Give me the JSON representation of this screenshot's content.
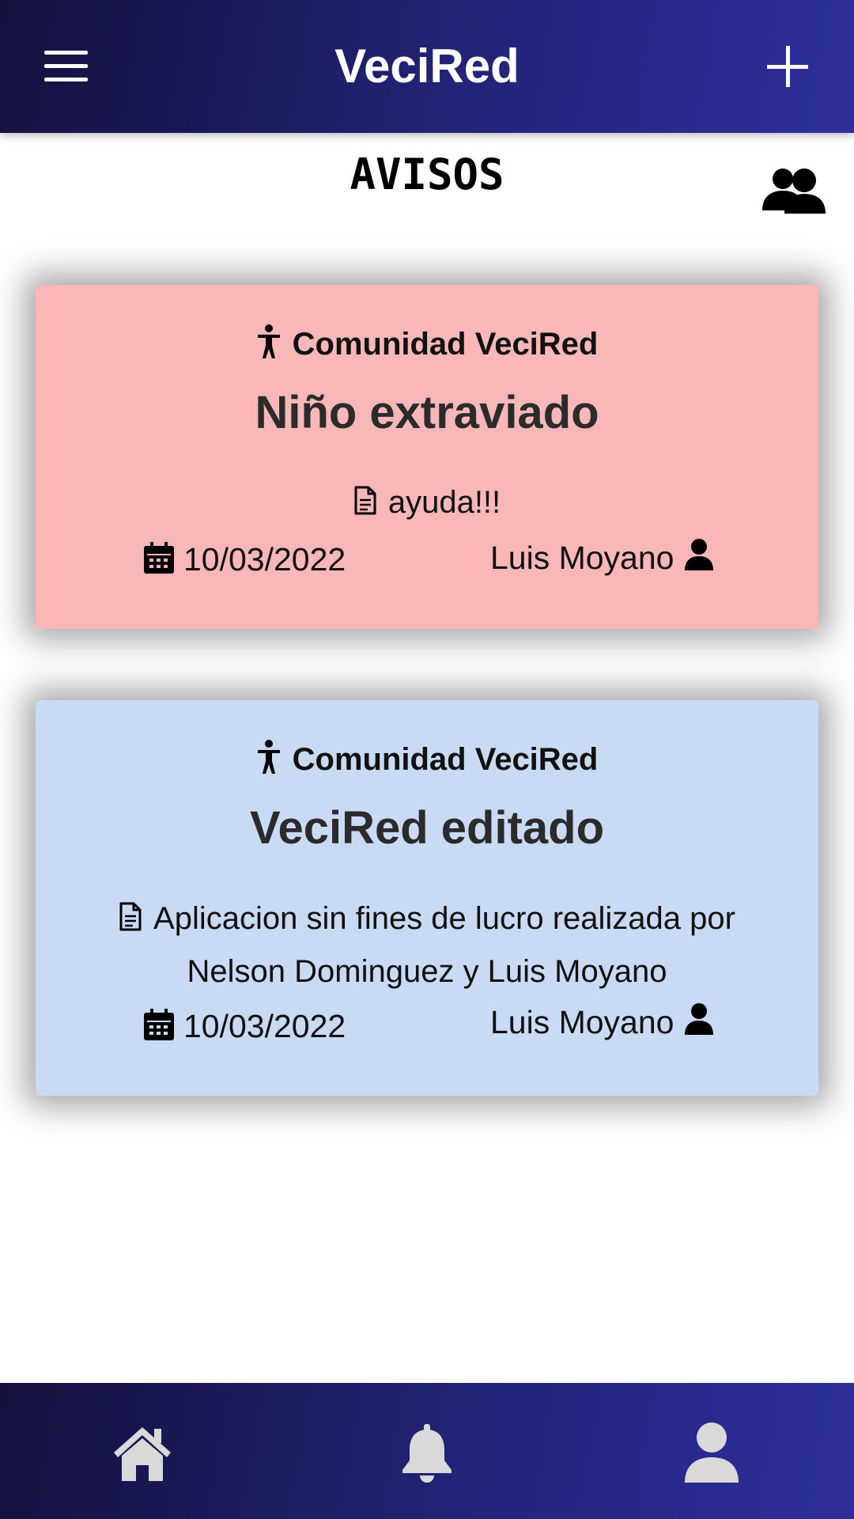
{
  "header": {
    "title": "VeciRed",
    "menu_icon": "hamburger-menu-icon",
    "add_icon": "plus-icon"
  },
  "page": {
    "title": "AVISOS",
    "users_icon": "users-icon"
  },
  "notices": [
    {
      "community": "Comunidad VeciRed",
      "title": "Niño extraviado",
      "description": "ayuda!!!",
      "date": "10/03/2022",
      "author": "Luis Moyano",
      "color": "#f9b7b7"
    },
    {
      "community": "Comunidad VeciRed",
      "title": "VeciRed editado",
      "description": "Aplicacion sin fines de lucro realizada por Nelson Dominguez y Luis Moyano",
      "date": "10/03/2022",
      "author": "Luis Moyano",
      "color": "#c9dbf4"
    }
  ],
  "bottom_nav": {
    "items": [
      "home-icon",
      "bell-icon",
      "user-profile-icon"
    ]
  },
  "colors": {
    "header_dark": "#14113d",
    "header_light": "#2e2f9c",
    "nav_icon": "#d9d9d9"
  }
}
